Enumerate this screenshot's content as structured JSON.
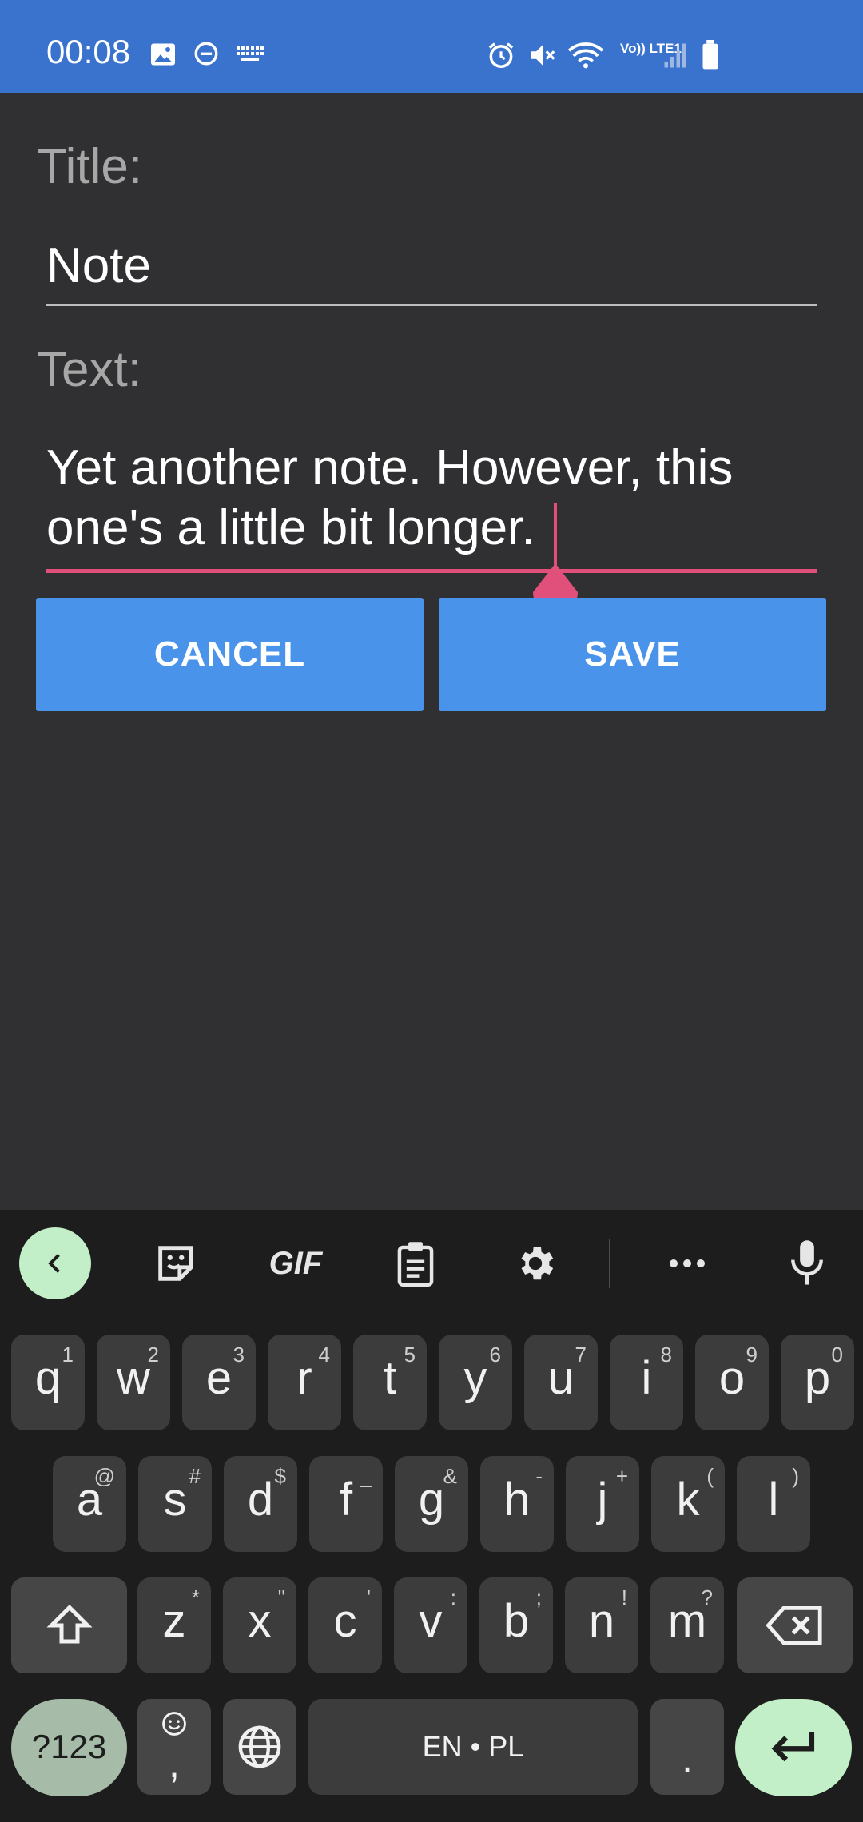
{
  "status_bar": {
    "time": "00:08",
    "network": "Vo)) LTE1",
    "icons": [
      "image-icon",
      "dnd-icon",
      "keyboard-icon",
      "alarm-icon",
      "mute-icon",
      "wifi-icon",
      "signal-icon",
      "battery-icon"
    ]
  },
  "form": {
    "title_label": "Title:",
    "title_value": "Note",
    "text_label": "Text:",
    "text_value": "Yet another note. However, this one's a little bit longer.",
    "cancel_label": "CANCEL",
    "save_label": "SAVE"
  },
  "colors": {
    "status_bar": "#3a73cd",
    "background": "#303032",
    "button": "#4a93eb",
    "accent": "#e0507a",
    "keyboard": "#1c1d1c"
  },
  "keyboard": {
    "toolbar": {
      "gif_label": "GIF",
      "icons": [
        "back-icon",
        "sticker-icon",
        "clipboard-icon",
        "settings-icon",
        "more-icon",
        "mic-icon"
      ]
    },
    "row1": [
      {
        "key": "q",
        "hint": "1"
      },
      {
        "key": "w",
        "hint": "2"
      },
      {
        "key": "e",
        "hint": "3"
      },
      {
        "key": "r",
        "hint": "4"
      },
      {
        "key": "t",
        "hint": "5"
      },
      {
        "key": "y",
        "hint": "6"
      },
      {
        "key": "u",
        "hint": "7"
      },
      {
        "key": "i",
        "hint": "8"
      },
      {
        "key": "o",
        "hint": "9"
      },
      {
        "key": "p",
        "hint": "0"
      }
    ],
    "row2": [
      {
        "key": "a",
        "hint": "@"
      },
      {
        "key": "s",
        "hint": "#"
      },
      {
        "key": "d",
        "hint": "$"
      },
      {
        "key": "f",
        "hint": "_"
      },
      {
        "key": "g",
        "hint": "&"
      },
      {
        "key": "h",
        "hint": "-"
      },
      {
        "key": "j",
        "hint": "+"
      },
      {
        "key": "k",
        "hint": "("
      },
      {
        "key": "l",
        "hint": ")"
      }
    ],
    "row3": [
      {
        "key": "z",
        "hint": "*"
      },
      {
        "key": "x",
        "hint": "\""
      },
      {
        "key": "c",
        "hint": "'"
      },
      {
        "key": "v",
        "hint": ":"
      },
      {
        "key": "b",
        "hint": ";"
      },
      {
        "key": "n",
        "hint": "!"
      },
      {
        "key": "m",
        "hint": "?"
      }
    ],
    "symbols_label": "?123",
    "emoji_comma": ",",
    "space_label": "EN • PL",
    "period_label": "."
  }
}
